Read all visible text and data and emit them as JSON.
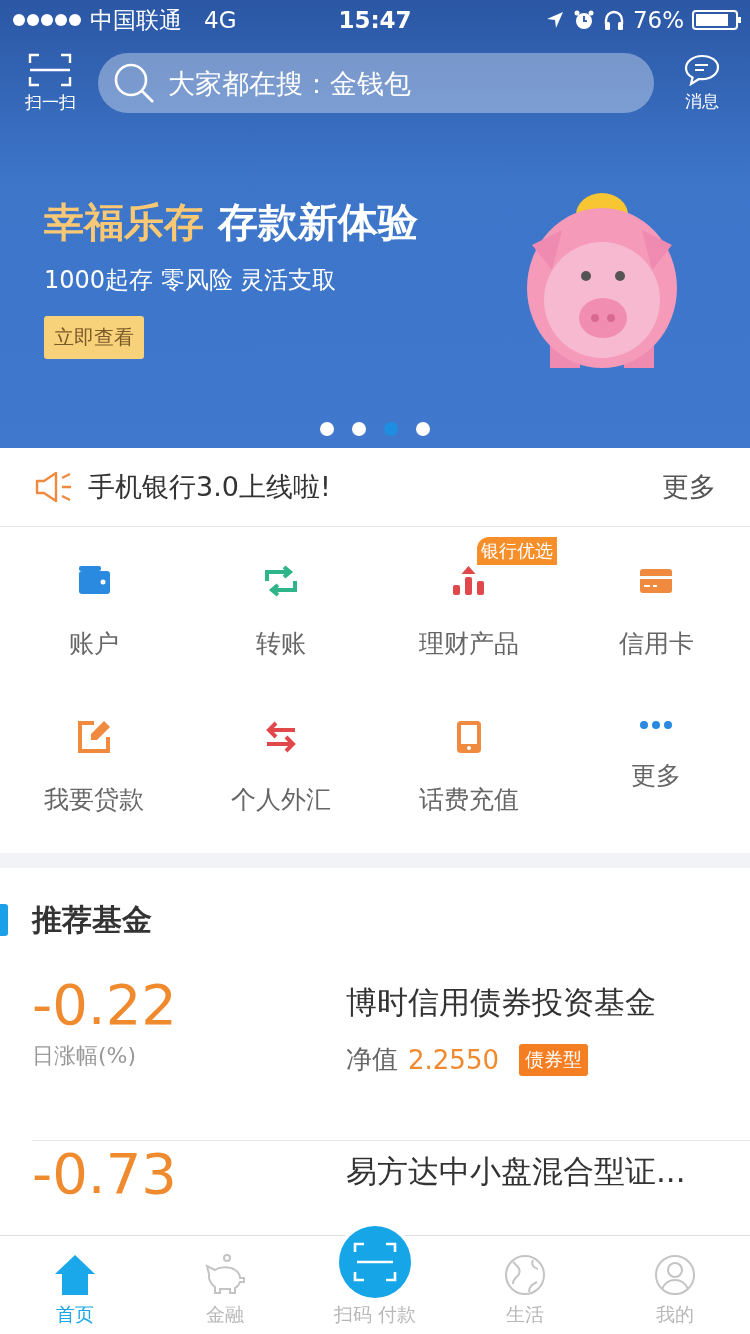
{
  "status_bar": {
    "carrier": "中国联通",
    "network": "4G",
    "time": "15:47",
    "battery": "76%"
  },
  "header": {
    "scan_label": "扫一扫",
    "search": {
      "placeholder": "大家都在搜：金钱包"
    },
    "messages_label": "消息"
  },
  "banner": {
    "title_highlight": "幸福乐存",
    "title": "存款新体验",
    "subtitle": "1000起存 零风险 灵活支取",
    "button": "立即查看",
    "dots": [
      {
        "selected": false
      },
      {
        "selected": false
      },
      {
        "selected": true
      },
      {
        "selected": false
      }
    ]
  },
  "notice": {
    "text": "手机银行3.0上线啦!",
    "more": "更多"
  },
  "services": [
    {
      "kind": "wallet",
      "label": "账户"
    },
    {
      "kind": "transfer",
      "label": "转账"
    },
    {
      "kind": "chart",
      "label": "理财产品",
      "badge": "银行优选"
    },
    {
      "kind": "card",
      "label": "信用卡"
    },
    {
      "kind": "edit",
      "label": "我要贷款"
    },
    {
      "kind": "exchange",
      "label": "个人外汇"
    },
    {
      "kind": "phone",
      "label": "话费充值"
    },
    {
      "kind": "more",
      "label": "更多"
    }
  ],
  "funds_section": {
    "title": "推荐基金",
    "funds": [
      {
        "change": "-0.22",
        "change_label": "日涨幅(%)",
        "name": "博时信用债券投资基金",
        "nav_label": "净值",
        "nav_value": "2.2550",
        "tag": "债券型"
      },
      {
        "change": "-0.73",
        "name": "易方达中小盘混合型证..."
      }
    ]
  },
  "tab_bar": [
    {
      "kind": "home",
      "label": "首页",
      "selected": true
    },
    {
      "kind": "piggy",
      "label": "金融",
      "selected": false
    },
    {
      "kind": "scan",
      "label": "扫码 付款",
      "selected": false
    },
    {
      "kind": "globe",
      "label": "生活",
      "selected": false
    },
    {
      "kind": "user",
      "label": "我的",
      "selected": false
    }
  ]
}
